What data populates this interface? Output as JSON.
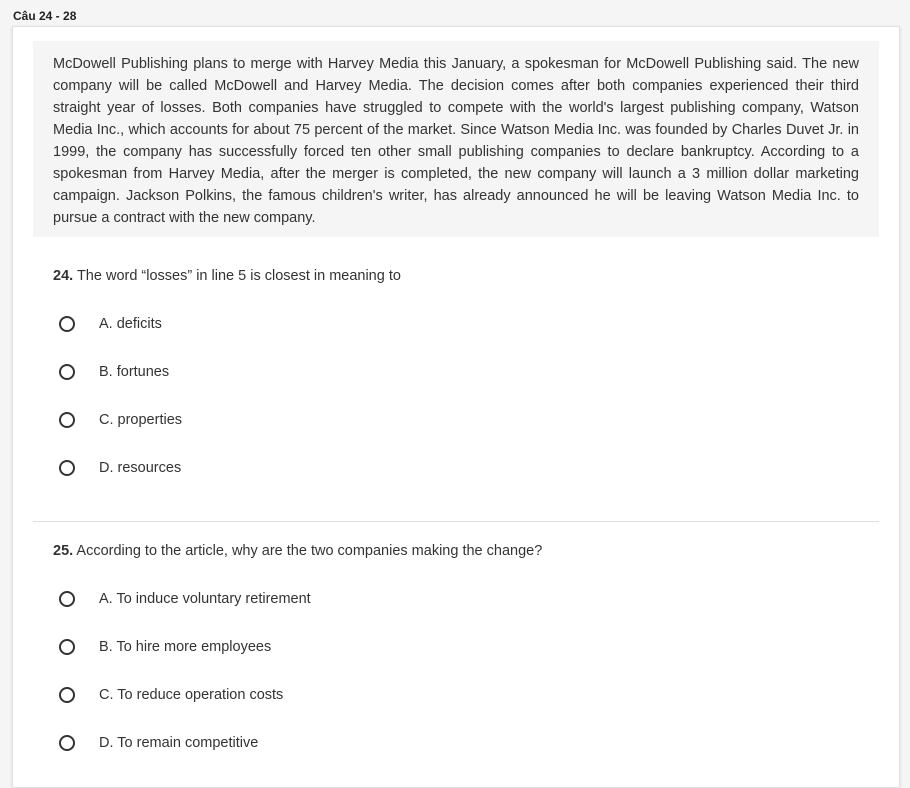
{
  "header": {
    "title": "Câu 24 - 28"
  },
  "passage": {
    "text": "McDowell Publishing plans to merge with Harvey Media this January, a spokesman for McDowell Publishing said. The new company will be called McDowell and Harvey Media. The decision comes after both companies experienced their third straight year of losses. Both companies have struggled to compete with the world's largest publishing company, Watson Media Inc., which accounts for about 75 percent of the market. Since Watson Media Inc. was founded by Charles Duvet Jr. in 1999, the company has successfully forced ten other small publishing companies to declare bankruptcy. According to a spokesman from Harvey Media, after the merger is completed, the new company will launch a 3 million dollar marketing campaign. Jackson Polkins, the famous children's writer, has already announced he will be leaving Watson Media Inc. to pursue a contract with the new company."
  },
  "questions": [
    {
      "number": "24.",
      "text": "The word “losses” in line 5 is closest in meaning to",
      "options": [
        "A. deficits",
        "B. fortunes",
        "C. properties",
        "D. resources"
      ]
    },
    {
      "number": "25.",
      "text": "According to the article, why are the two companies making the change?",
      "options": [
        "A. To induce voluntary retirement",
        "B. To hire more employees",
        "C. To reduce operation costs",
        "D. To remain competitive"
      ]
    }
  ]
}
